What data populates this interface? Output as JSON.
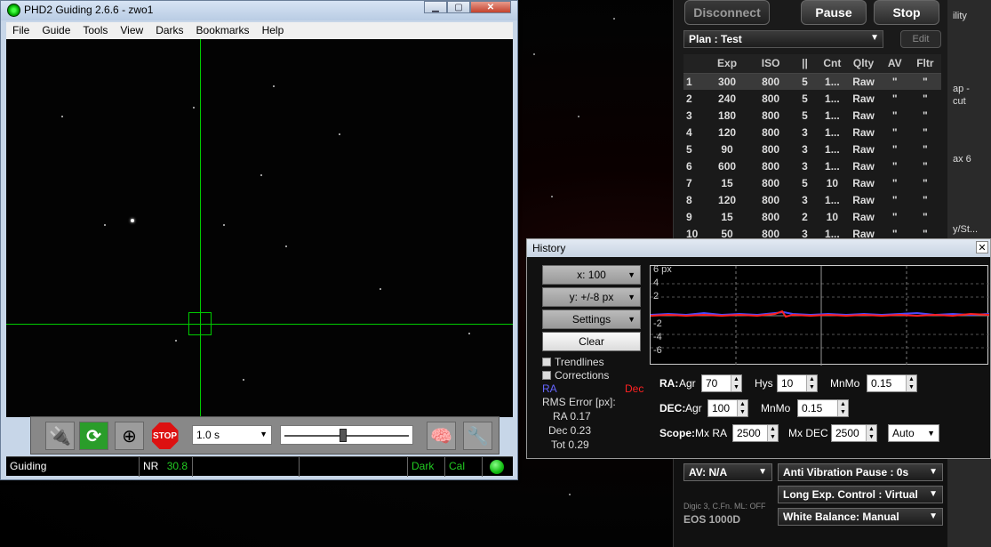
{
  "phd": {
    "title": "PHD2 Guiding 2.6.6 - zwo1",
    "menu": [
      "File",
      "Guide",
      "Tools",
      "View",
      "Darks",
      "Bookmarks",
      "Help"
    ],
    "exposure": "1.0 s",
    "status": {
      "state": "Guiding",
      "snr_label": "NR",
      "snr_value": "30.8",
      "dark": "Dark",
      "cal": "Cal"
    },
    "stop_label": "STOP",
    "colors": {
      "crosshair": "#00cc00",
      "status_ok": "#22cc22"
    }
  },
  "history": {
    "title": "History",
    "x_scale": "x: 100",
    "y_scale": "y: +/-8 px",
    "settings": "Settings",
    "clear": "Clear",
    "trendlines": "Trendlines",
    "corrections": "Corrections",
    "legend_ra": "RA",
    "legend_dec": "Dec",
    "rms_title": "RMS Error [px]:",
    "rms_ra": "RA 0.17",
    "rms_dec": "Dec 0.23",
    "rms_tot": "Tot 0.29",
    "y_labels": [
      "6 px",
      "4",
      "2",
      "-2",
      "-4",
      "-6"
    ],
    "ra_label": "RA:",
    "agr_label": "Agr",
    "ra_agr": "70",
    "hys_label": "Hys",
    "ra_hys": "10",
    "mnmo_label": "MnMo",
    "ra_mnmo": "0.15",
    "dec_label": "DEC:",
    "dec_agr": "100",
    "dec_mnmo": "0.15",
    "scope_label": "Scope:",
    "mx_ra_label": "Mx RA",
    "mx_ra": "2500",
    "mx_dec_label": "Mx DEC",
    "mx_dec": "2500",
    "dec_mode": "Auto",
    "colors": {
      "ra": "#4a4aff",
      "dec": "#ff2020"
    }
  },
  "right_app": {
    "disconnect": "Disconnect",
    "pause": "Pause",
    "stop": "Stop",
    "plan": "Plan : Test",
    "edit": "Edit",
    "columns": [
      "",
      "Exp",
      "ISO",
      "||",
      "Cnt",
      "Qlty",
      "AV",
      "Fltr"
    ],
    "rows": [
      [
        "1",
        "300",
        "800",
        "5",
        "1...",
        "Raw",
        "\"",
        "\""
      ],
      [
        "2",
        "240",
        "800",
        "5",
        "1...",
        "Raw",
        "\"",
        "\""
      ],
      [
        "3",
        "180",
        "800",
        "5",
        "1...",
        "Raw",
        "\"",
        "\""
      ],
      [
        "4",
        "120",
        "800",
        "3",
        "1...",
        "Raw",
        "\"",
        "\""
      ],
      [
        "5",
        "90",
        "800",
        "3",
        "1...",
        "Raw",
        "\"",
        "\""
      ],
      [
        "6",
        "600",
        "800",
        "3",
        "1...",
        "Raw",
        "\"",
        "\""
      ],
      [
        "7",
        "15",
        "800",
        "5",
        "10",
        "Raw",
        "\"",
        "\""
      ],
      [
        "8",
        "120",
        "800",
        "3",
        "1...",
        "Raw",
        "\"",
        "\""
      ],
      [
        "9",
        "15",
        "800",
        "2",
        "10",
        "Raw",
        "\"",
        "\""
      ],
      [
        "10",
        "50",
        "800",
        "3",
        "1...",
        "Raw",
        "\"",
        "\""
      ]
    ],
    "av": "AV: N/A",
    "anti_vib": "Anti Vibration Pause : 0s",
    "long_exp": "Long Exp. Control : Virtual",
    "white_balance": "White Balance: Manual",
    "digic": "Digic 3, C.Fn. ML: OFF",
    "camera": "EOS 1000D",
    "strip_texts": [
      "ility",
      "ap -",
      "cut",
      "ax 6",
      "y/St..."
    ]
  }
}
